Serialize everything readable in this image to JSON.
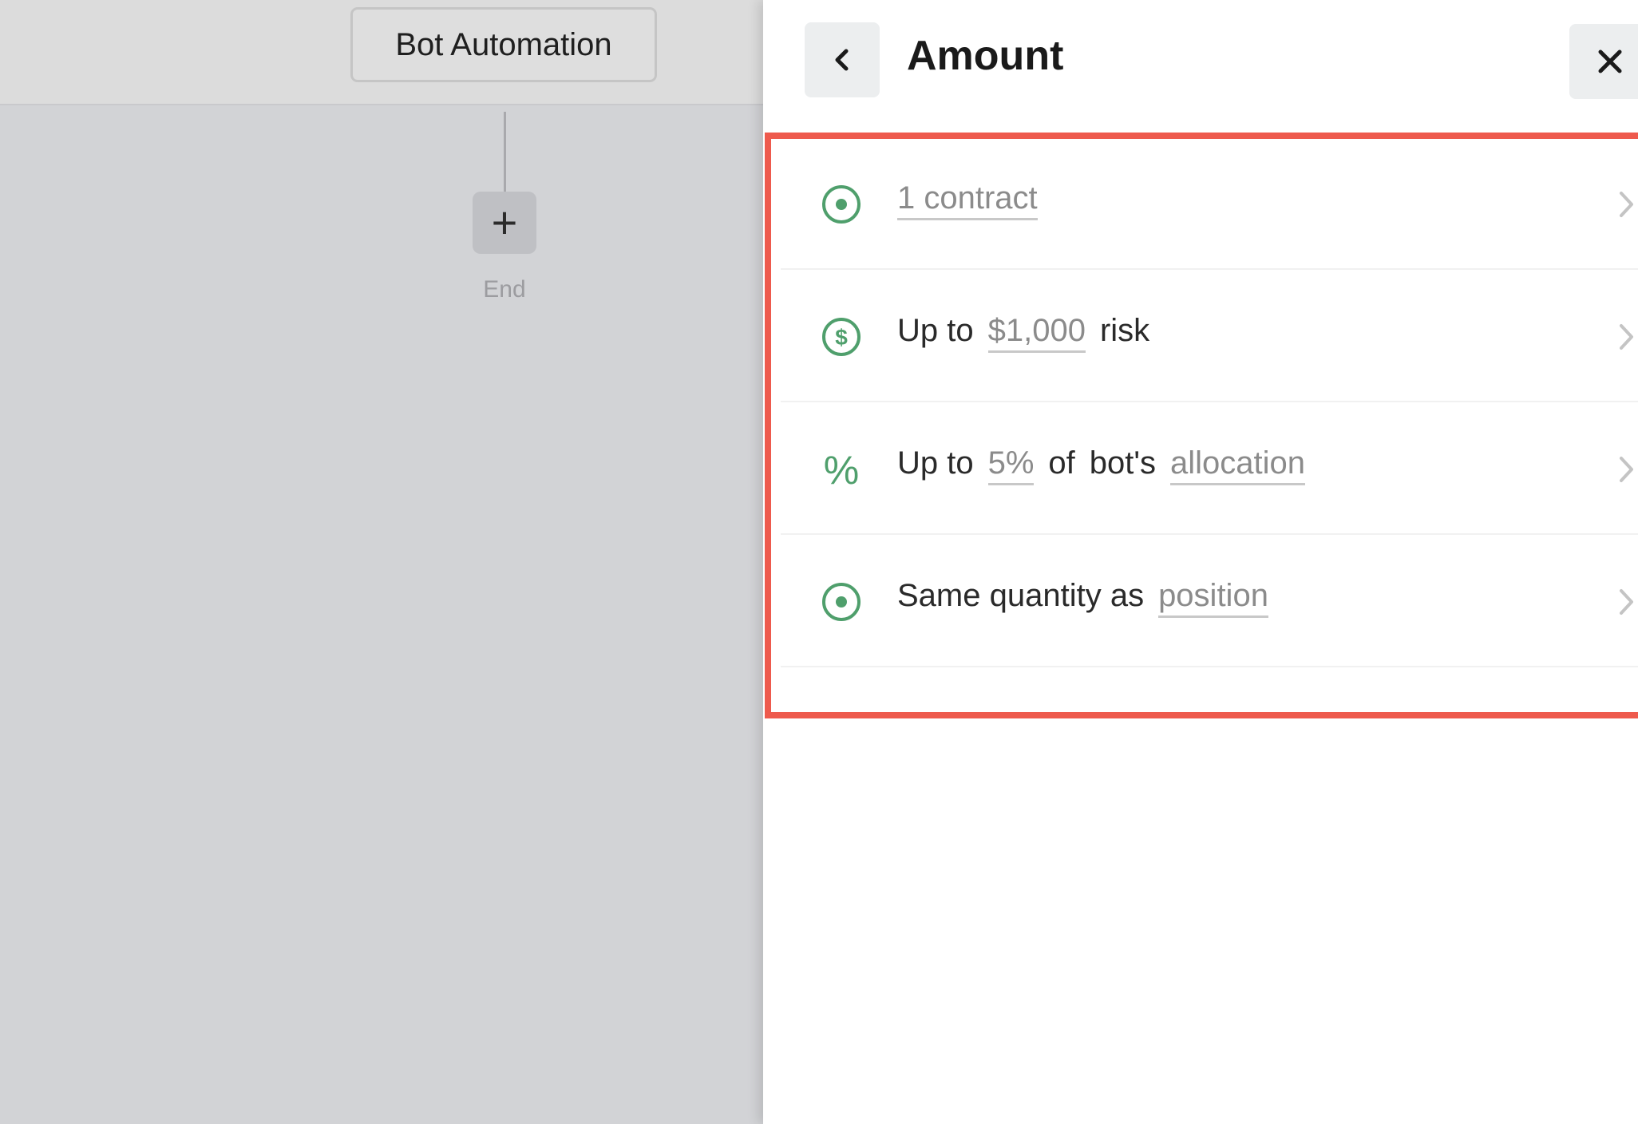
{
  "canvas": {
    "bot_button_label": "Bot Automation",
    "add_step_symbol": "+",
    "end_label": "End"
  },
  "panel": {
    "title": "Amount",
    "options": [
      {
        "icon": "radio-icon",
        "value": "1 contract"
      },
      {
        "icon": "dollar-circle-icon",
        "prefix": "Up to",
        "value": "$1,000",
        "suffix": "risk"
      },
      {
        "icon": "percent-icon",
        "prefix": "Up to",
        "value": "5%",
        "middle_1": "of",
        "middle_2": "bot's",
        "value_2": "allocation"
      },
      {
        "icon": "radio-icon",
        "prefix": "Same quantity as",
        "value": "position"
      }
    ]
  },
  "colors": {
    "accent_green": "#4f9f6c",
    "highlight_border": "#ee5a4d"
  }
}
